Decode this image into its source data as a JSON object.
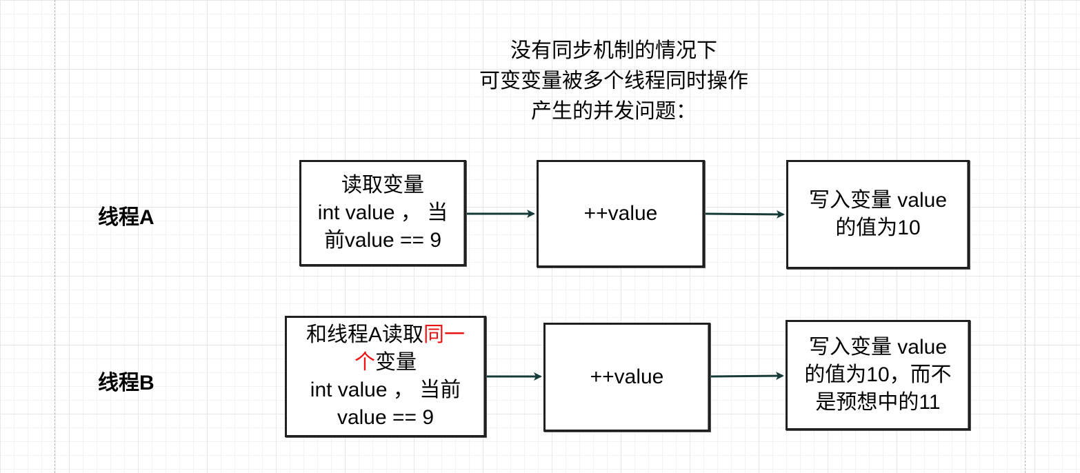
{
  "title": {
    "line1": "没有同步机制的情况下",
    "line2": "可变变量被多个线程同时操作",
    "line3": "产生的并发问题："
  },
  "thread_a": {
    "label": "线程A",
    "read_box": {
      "line1": "读取变量",
      "line2": "int value ， 当",
      "line3": "前value == 9"
    },
    "inc_box": "++value",
    "write_box": {
      "line1": "写入变量 value",
      "line2": "的值为10"
    }
  },
  "thread_b": {
    "label": "线程B",
    "read_box": {
      "line1_prefix": "和线程A读取",
      "line1_highlight": "同一",
      "line2_highlight": "个",
      "line2_suffix": "变量",
      "line3": "int value ， 当前",
      "line4": "value == 9"
    },
    "inc_box": "++value",
    "write_box": {
      "line1": "写入变量 value",
      "line2": "的值为10，而不",
      "line3": "是预想中的11"
    }
  },
  "colors": {
    "arrow": "#163a3a",
    "highlight": "#ee1111",
    "box_border": "#1f1f1f"
  }
}
